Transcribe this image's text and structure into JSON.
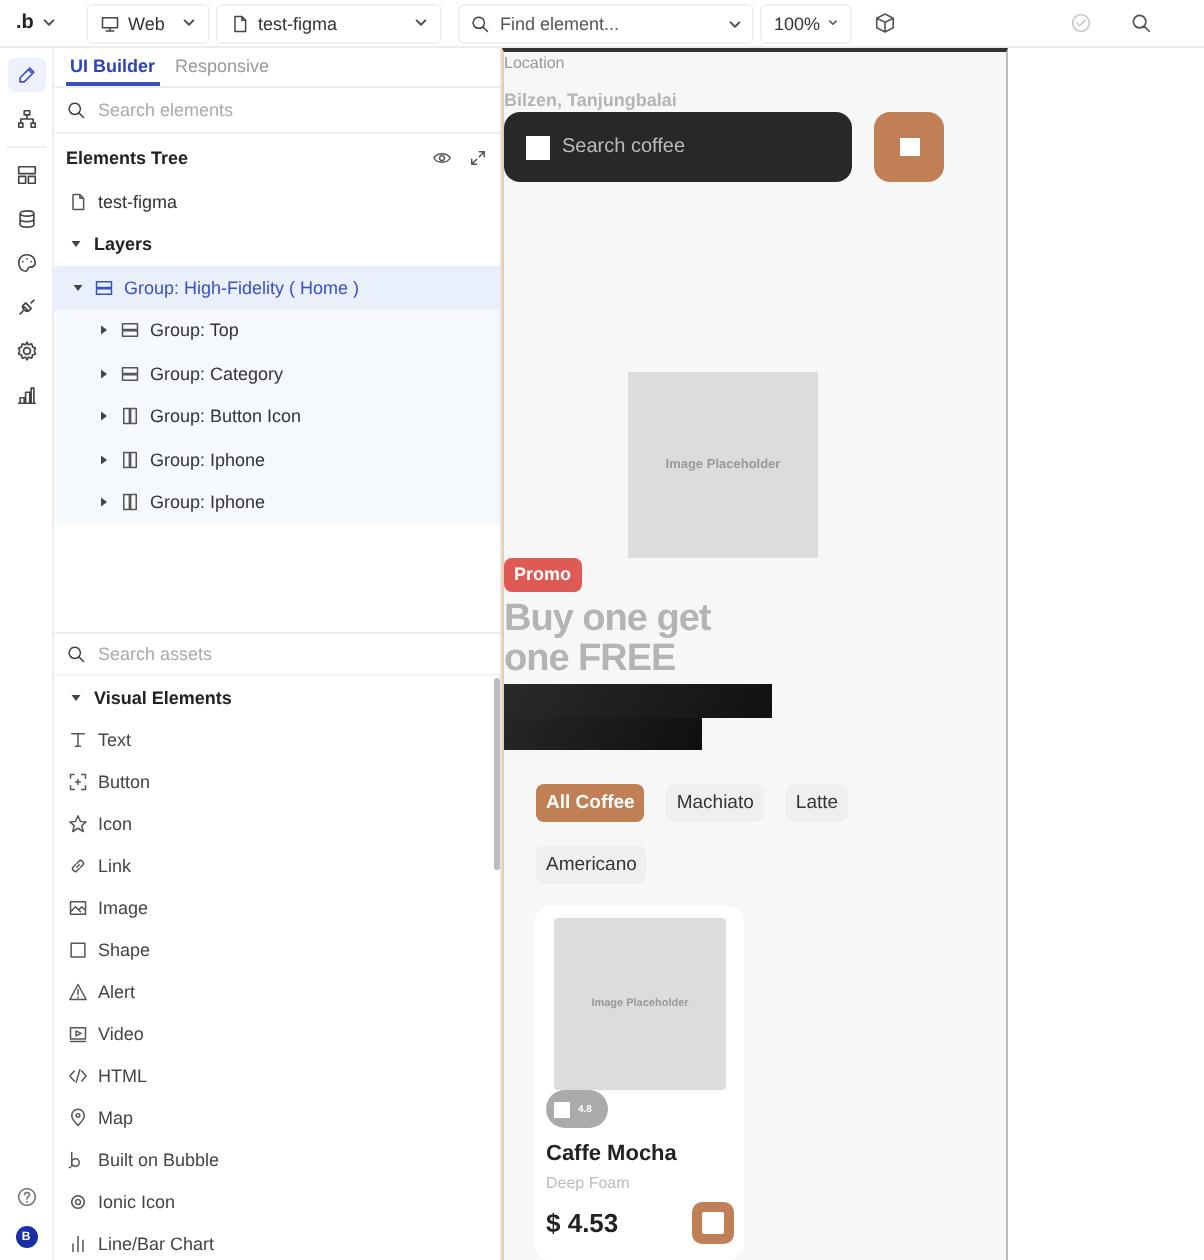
{
  "toolbar": {
    "logo": ".b",
    "platform": "Web",
    "page": "test-figma",
    "find": {
      "placeholder": "Find element..."
    },
    "zoom": "100%"
  },
  "rail": {
    "items": [
      {
        "kind": "pencil",
        "selected": true
      },
      {
        "kind": "hierarchy",
        "selected": false
      },
      {
        "kind": "layout",
        "selected": false
      },
      {
        "kind": "database",
        "selected": false
      },
      {
        "kind": "palette",
        "selected": false
      },
      {
        "kind": "plug",
        "selected": false
      },
      {
        "kind": "gear",
        "selected": false
      },
      {
        "kind": "chart",
        "selected": false
      }
    ],
    "avatar": "B"
  },
  "panel": {
    "tabs": [
      {
        "label": "UI Builder",
        "selected": true
      },
      {
        "label": "Responsive",
        "selected": false
      }
    ],
    "search": {
      "placeholder": "Search elements"
    },
    "tree_title": "Elements Tree",
    "root": "test-figma",
    "layers": {
      "label": "Layers",
      "expanded": true,
      "children": [
        {
          "label": "Group: High-Fidelity ( Home )",
          "kind": "rows",
          "selected": true,
          "expanded": true,
          "children": [
            {
              "label": "Group: Top",
              "kind": "rows",
              "selected": false,
              "expanded": false
            },
            {
              "label": "Group: Category",
              "kind": "rows",
              "selected": false,
              "expanded": false
            },
            {
              "label": "Group: Button Icon",
              "kind": "columns",
              "selected": false,
              "expanded": false
            },
            {
              "label": "Group: Iphone",
              "kind": "columns",
              "selected": false,
              "expanded": false
            },
            {
              "label": "Group: Iphone",
              "kind": "columns",
              "selected": false,
              "expanded": false
            }
          ]
        }
      ]
    },
    "assets_search": {
      "placeholder": "Search assets"
    },
    "section": {
      "label": "Visual Elements",
      "expanded": true
    },
    "elements": [
      {
        "label": "Text",
        "kind": "text"
      },
      {
        "label": "Button",
        "kind": "button"
      },
      {
        "label": "Icon",
        "kind": "star"
      },
      {
        "label": "Link",
        "kind": "link"
      },
      {
        "label": "Image",
        "kind": "image"
      },
      {
        "label": "Shape",
        "kind": "shape"
      },
      {
        "label": "Alert",
        "kind": "alert"
      },
      {
        "label": "Video",
        "kind": "video"
      },
      {
        "label": "HTML",
        "kind": "code"
      },
      {
        "label": "Map",
        "kind": "pin"
      },
      {
        "label": "Built on Bubble",
        "kind": "bubble"
      },
      {
        "label": "Ionic Icon",
        "kind": "dot"
      },
      {
        "label": "Line/Bar Chart",
        "kind": "chart"
      }
    ]
  },
  "canvas": {
    "location_label": "Location",
    "location": "Bilzen, Tanjungbalai",
    "search": {
      "placeholder": "Search coffee"
    },
    "banner_image": "Image Placeholder",
    "promo": "Promo",
    "headline": "Buy one get one FREE",
    "categories": [
      {
        "label": "All Coffee",
        "selected": true
      },
      {
        "label": "Machiato",
        "selected": false
      },
      {
        "label": "Latte",
        "selected": false
      },
      {
        "label": "Americano",
        "selected": false
      }
    ],
    "product": {
      "image": "Image Placeholder",
      "rating": "4.8",
      "name": "Caffe Mocha",
      "subtitle": "Deep Foam",
      "price": "$ 4.53"
    }
  }
}
